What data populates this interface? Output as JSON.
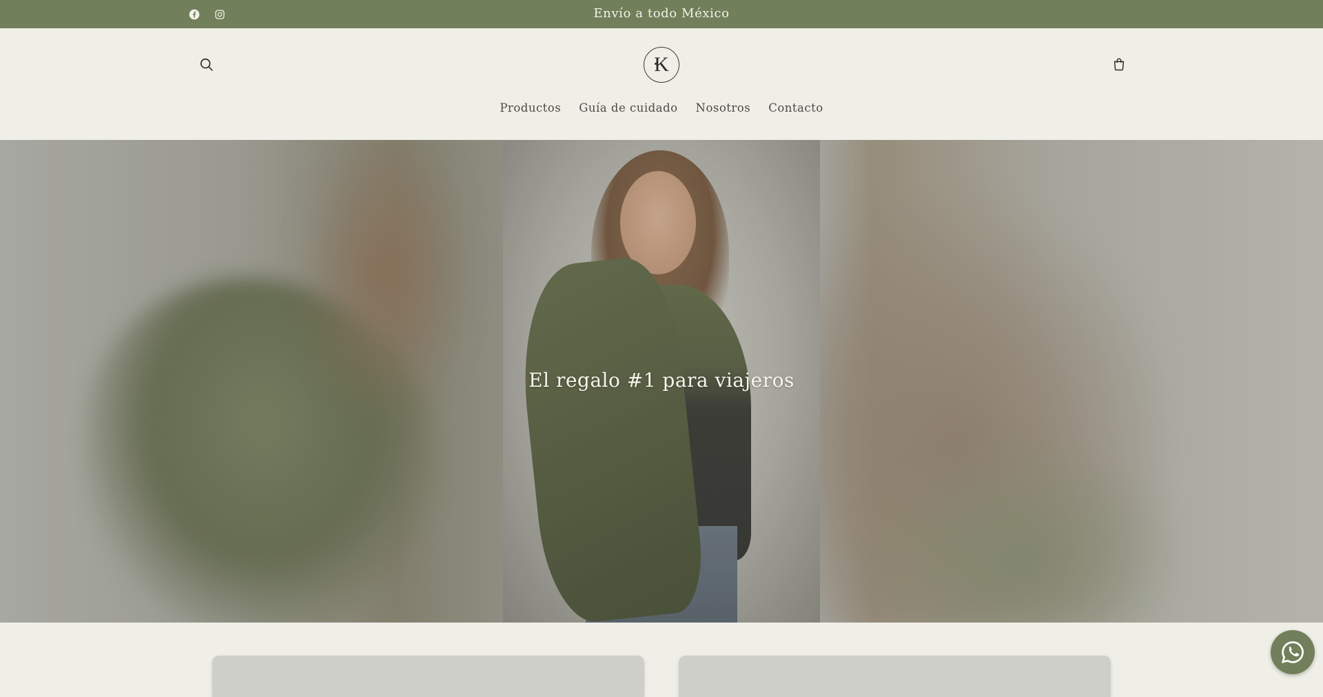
{
  "announcement": {
    "message": "Envío a todo México",
    "social": [
      {
        "name": "facebook-icon"
      },
      {
        "name": "instagram-icon"
      }
    ]
  },
  "header": {
    "logo_text": "K",
    "search_icon": "search-icon",
    "cart_icon": "cart-icon"
  },
  "nav": {
    "items": [
      {
        "label": "Productos"
      },
      {
        "label": "Guía de cuidado"
      },
      {
        "label": "Nosotros"
      },
      {
        "label": "Contacto"
      }
    ]
  },
  "hero": {
    "headline": "El regalo #1 para viajeros"
  },
  "colors": {
    "brand_green": "#717f5a",
    "background": "#efeee7",
    "text": "#3a3a35"
  },
  "floating": {
    "whatsapp_icon": "whatsapp-icon"
  }
}
